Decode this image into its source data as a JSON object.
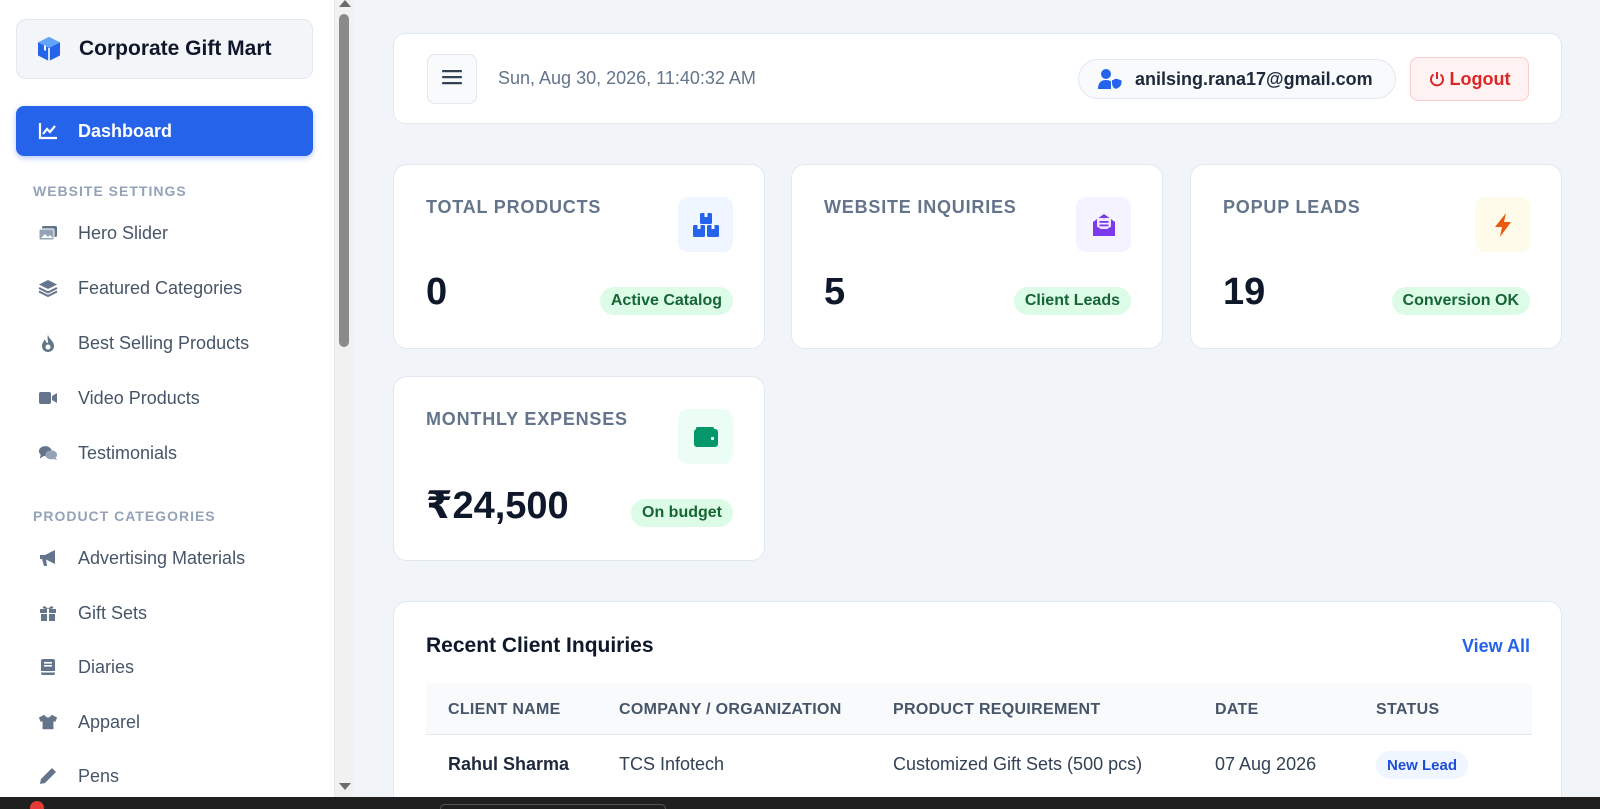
{
  "brand": {
    "title": "Corporate Gift Mart"
  },
  "sidebar": {
    "active": {
      "label": "Dashboard"
    },
    "sections": [
      {
        "label": "WEBSITE SETTINGS",
        "items": [
          "Hero Slider",
          "Featured Categories",
          "Best Selling Products",
          "Video Products",
          "Testimonials"
        ]
      },
      {
        "label": "PRODUCT CATEGORIES",
        "items": [
          "Advertising Materials",
          "Gift Sets",
          "Diaries",
          "Apparel",
          "Pens"
        ]
      }
    ]
  },
  "header": {
    "datetime": "Sun, Aug 30, 2026, 11:40:32 AM",
    "user_email": "anilsing.rana17@gmail.com",
    "logout_label": "Logout"
  },
  "stats": [
    {
      "label": "TOTAL PRODUCTS",
      "value": "0",
      "badge": "Active Catalog",
      "icon": "boxes-icon",
      "icon_color": "#2563eb",
      "icon_bg": "#eff6ff"
    },
    {
      "label": "WEBSITE INQUIRIES",
      "value": "5",
      "badge": "Client Leads",
      "icon": "envelope-open-icon",
      "icon_color": "#7c3aed",
      "icon_bg": "#f5f3ff"
    },
    {
      "label": "POPUP LEADS",
      "value": "19",
      "badge": "Conversion OK",
      "icon": "bolt-icon",
      "icon_color": "#ea580c",
      "icon_bg": "#fffbeb"
    },
    {
      "label": "MONTHLY EXPENSES",
      "value": "₹24,500",
      "badge": "On budget",
      "icon": "wallet-icon",
      "icon_color": "#059669",
      "icon_bg": "#ecfdf5"
    }
  ],
  "inquiries": {
    "title": "Recent Client Inquiries",
    "view_all": "View All",
    "columns": [
      "CLIENT NAME",
      "COMPANY / ORGANIZATION",
      "PRODUCT REQUIREMENT",
      "DATE",
      "STATUS"
    ],
    "rows": [
      {
        "client": "Rahul Sharma",
        "company": "TCS Infotech",
        "requirement": "Customized Gift Sets (500 pcs)",
        "date": "07 Aug 2026",
        "status": "New Lead"
      }
    ]
  },
  "colors": {
    "accent": "#2563eb",
    "danger": "#dc2626",
    "success_bg": "#dcfce7",
    "success_text": "#166534"
  }
}
